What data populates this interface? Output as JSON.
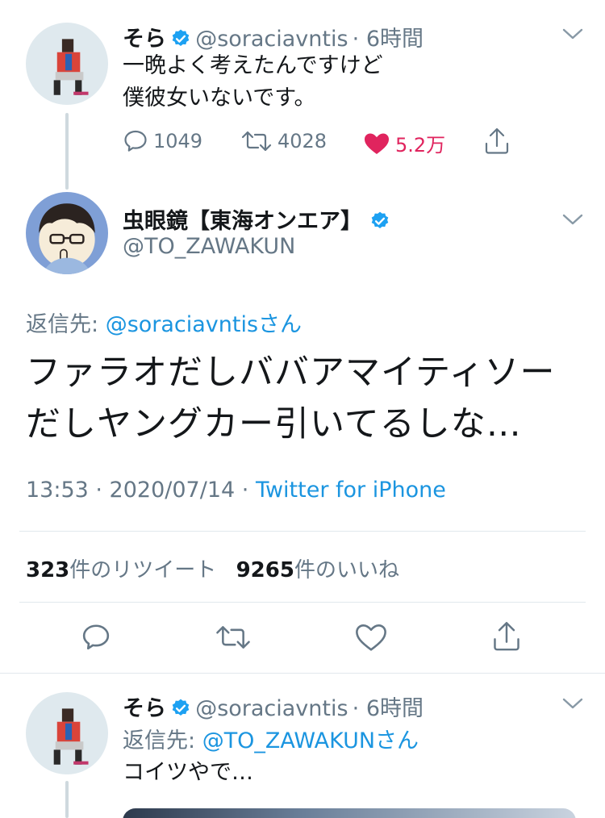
{
  "tweet1": {
    "name": "そら",
    "handle": "@soraciavntis",
    "time": "· 6時間",
    "lines": [
      "一晩よく考えたんですけど",
      "僕彼女いないです。"
    ],
    "reply_count": "1049",
    "retweet_count": "4028",
    "like_count": "5.2万"
  },
  "main_tweet": {
    "name": "虫眼鏡【東海オンエア】",
    "handle": "@TO_ZAWAKUN",
    "reply_prefix": "返信先: ",
    "reply_to": "@soraciavntisさん",
    "lines": [
      "ファラオだしババアマイティソー",
      "だしヤングカー引いてるしな…"
    ],
    "timestamp": "13:53 · 2020/07/14 · ",
    "source": "Twitter for iPhone",
    "retweets_count": "323",
    "retweets_label": "件のリツイート",
    "likes_count": "9265",
    "likes_label": "件のいいね"
  },
  "tweet3": {
    "name": "そら",
    "handle": "@soraciavntis",
    "time": "· 6時間",
    "reply_prefix": "返信先: ",
    "reply_to": "@TO_ZAWAKUNさん",
    "text": "コイツやで…"
  },
  "colors": {
    "accent": "#1b95e0",
    "verified": "#1da1f2",
    "like": "#e0245e",
    "muted": "#657786"
  }
}
